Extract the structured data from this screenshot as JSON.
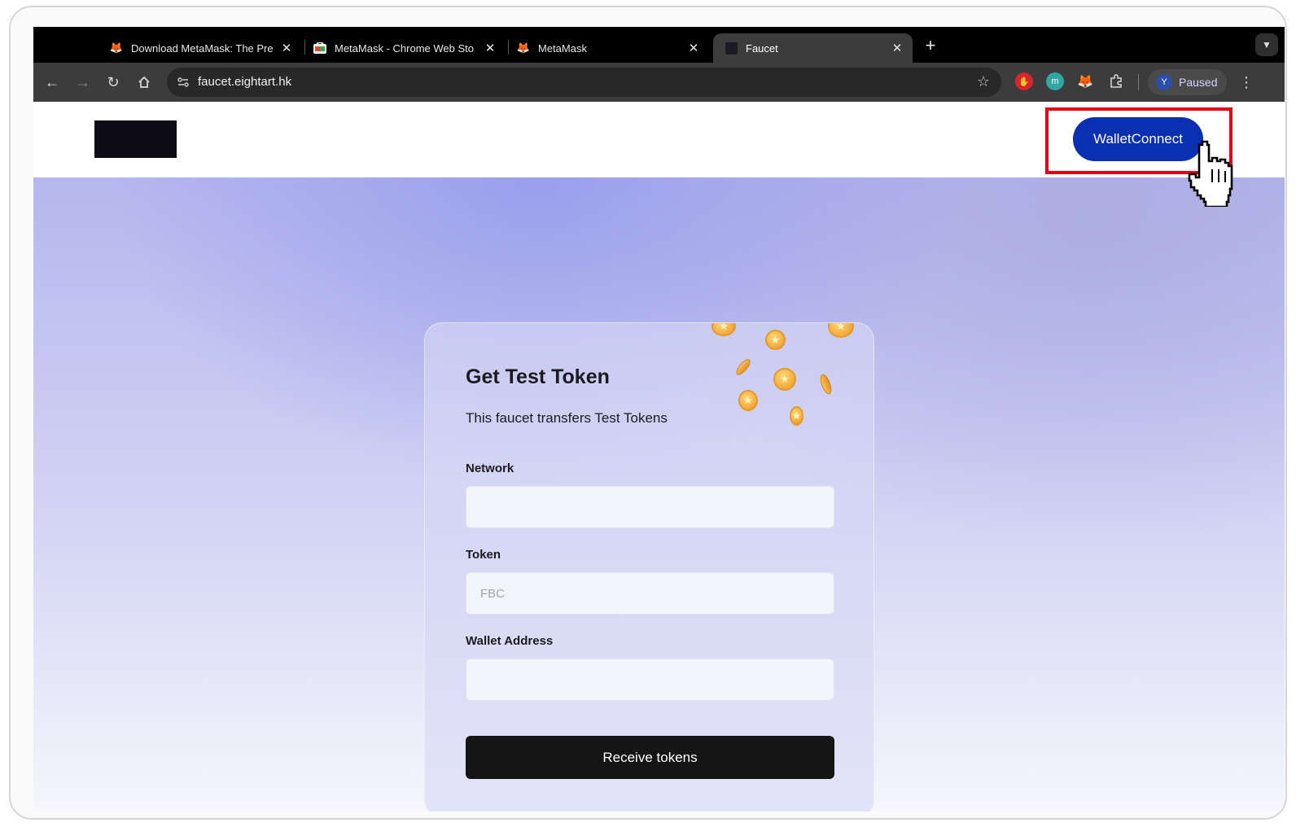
{
  "browser": {
    "tabs": [
      {
        "title": "Download MetaMask: The Pre",
        "icon": "fox-icon",
        "active": false
      },
      {
        "title": "MetaMask - Chrome Web Sto",
        "icon": "webstore-icon",
        "active": false
      },
      {
        "title": "MetaMask",
        "icon": "fox-icon",
        "active": false
      },
      {
        "title": "Faucet",
        "icon": "dark-square-icon",
        "active": true
      }
    ],
    "url": "faucet.eightart.hk",
    "profile_initial": "Y",
    "profile_status": "Paused",
    "extension_m_label": "m"
  },
  "header": {
    "wallet_button_label": "WalletConnect"
  },
  "card": {
    "title": "Get Test Token",
    "subtitle": "This faucet transfers Test Tokens",
    "network_label": "Network",
    "network_value": "",
    "token_label": "Token",
    "token_placeholder": "FBC",
    "wallet_label": "Wallet Address",
    "wallet_value": "",
    "submit_label": "Receive tokens"
  },
  "colors": {
    "accent_button": "#0a2fb0",
    "highlight_box": "#e60012",
    "submit_button": "#151515"
  }
}
